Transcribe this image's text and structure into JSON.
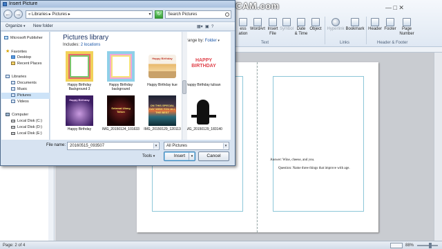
{
  "watermark": "www.BANDICAM.com",
  "ribbon": {
    "buttons": [
      {
        "label": "ess",
        "sub": "ation"
      },
      {
        "label": "WordArt"
      },
      {
        "label": "Insert",
        "sub": "File"
      },
      {
        "label": "Symbol"
      },
      {
        "label": "Date",
        "sub": "& Time"
      },
      {
        "label": "Object"
      },
      {
        "label": "Hyperlink"
      },
      {
        "label": "Bookmark"
      },
      {
        "label": "Header"
      },
      {
        "label": "Footer"
      },
      {
        "label": "Page",
        "sub": "Number"
      }
    ],
    "groups": [
      "Text",
      "Links",
      "Header & Footer"
    ]
  },
  "document": {
    "answer": "Answer:  Wine, cheese, and you.",
    "question": "Question:  Name three things that improve with age."
  },
  "status": {
    "page": "Page: 2 of 4",
    "zoom": "88%"
  },
  "dialog": {
    "title": "Insert Picture",
    "breadcrumb": "« Libraries ▸ Pictures ▸",
    "search_placeholder": "Search Pictures",
    "toolbar": {
      "organize": "Organize",
      "new_folder": "New folder"
    },
    "sidebar": [
      {
        "label": "Microsoft Publisher",
        "icon": "publisher-icon"
      },
      {
        "label": "Favorites",
        "icon": "star-icon"
      },
      {
        "label": "Desktop",
        "icon": "desktop-icon"
      },
      {
        "label": "Recent Places",
        "icon": "recent-places-icon"
      },
      {
        "label": "Libraries",
        "icon": "library-icon"
      },
      {
        "label": "Documents",
        "icon": "documents-icon"
      },
      {
        "label": "Music",
        "icon": "music-icon"
      },
      {
        "label": "Pictures",
        "icon": "pictures-icon",
        "selected": true
      },
      {
        "label": "Videos",
        "icon": "videos-icon"
      },
      {
        "label": "Computer",
        "icon": "computer-icon"
      },
      {
        "label": "Local Disk (C:)",
        "icon": "disk-icon"
      },
      {
        "label": "Local Disk (D:)",
        "icon": "disk-icon"
      },
      {
        "label": "Local Disk (E:)",
        "icon": "disk-icon"
      }
    ],
    "library": {
      "title": "Pictures library",
      "includes_label": "Includes: ",
      "includes_value": "2 locations",
      "arrange_label": "Arrange by:",
      "arrange_value": "Folder"
    },
    "thumbnails": [
      {
        "caption": "Happy Birthday Background 3"
      },
      {
        "caption": "Happy Birthday background"
      },
      {
        "caption": "Happy Birthday kue",
        "inner": "Happy Birthday"
      },
      {
        "caption": "happy Birthday tulisan",
        "inner": "HAPPY BIRTHDAY"
      },
      {
        "caption": "Happy Birthday",
        "inner": "Happy Birthday"
      },
      {
        "caption": "IMG_20150124_101633",
        "inner": "Selamat Ulang Tahun"
      },
      {
        "caption": "IMG_20150129_120113",
        "inner": "ON THIS SPECIAL DAY WISH YOU ALL THE BEST"
      },
      {
        "caption": "IMG_20150129_183140"
      }
    ],
    "file_name_label": "File name:",
    "file_name_value": "20160515_093507",
    "filter_value": "All Pictures",
    "tools_label": "Tools",
    "insert_label": "Insert",
    "cancel_label": "Cancel"
  }
}
